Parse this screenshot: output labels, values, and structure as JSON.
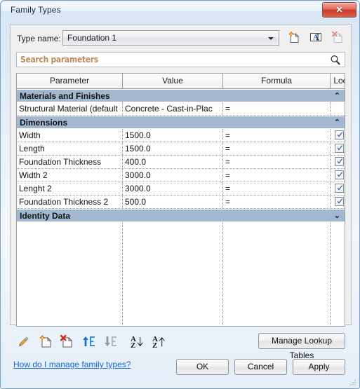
{
  "window": {
    "title": "Family Types",
    "close_label": "✕"
  },
  "typeRow": {
    "label": "Type name:",
    "value": "Foundation 1",
    "actions": [
      {
        "name": "new-type-icon",
        "title": "New Type"
      },
      {
        "name": "rename-type-icon",
        "title": "Rename Type"
      },
      {
        "name": "delete-type-icon",
        "title": "Delete Type"
      }
    ]
  },
  "search": {
    "placeholder": "Search parameters",
    "value": ""
  },
  "grid": {
    "columns": [
      "Parameter",
      "Value",
      "Formula",
      "Lock"
    ],
    "groups": [
      {
        "name": "Materials and Finishes",
        "expanded": true,
        "chevron": "⌃",
        "rows": [
          {
            "parameter": "Structural Material (default",
            "value": "Concrete - Cast-in-Plac",
            "formula": "=",
            "lock": false
          }
        ]
      },
      {
        "name": "Dimensions",
        "expanded": true,
        "chevron": "⌃",
        "rows": [
          {
            "parameter": "Width",
            "value": "1500.0",
            "formula": "=",
            "lock": true
          },
          {
            "parameter": "Length",
            "value": "1500.0",
            "formula": "=",
            "lock": true
          },
          {
            "parameter": "Foundation Thickness",
            "value": "400.0",
            "formula": "=",
            "lock": true
          },
          {
            "parameter": "Width 2",
            "value": "3000.0",
            "formula": "=",
            "lock": true
          },
          {
            "parameter": "Lenght 2",
            "value": "3000.0",
            "formula": "=",
            "lock": true
          },
          {
            "parameter": "Foundation Thickness 2",
            "value": "500.0",
            "formula": "=",
            "lock": true
          }
        ]
      },
      {
        "name": "Identity Data",
        "expanded": false,
        "chevron": "⌄",
        "rows": []
      }
    ]
  },
  "toolbar": [
    {
      "name": "edit-parameter-icon",
      "title": "Edit Parameter"
    },
    {
      "name": "new-parameter-icon",
      "title": "New Parameter"
    },
    {
      "name": "delete-parameter-icon",
      "title": "Remove Parameter"
    },
    {
      "name": "move-parameter-up-icon",
      "title": "Move Up"
    },
    {
      "name": "move-parameter-down-icon",
      "title": "Move Down"
    },
    {
      "name": "sort-descending-icon",
      "title": "Sort Descending"
    },
    {
      "name": "sort-ascending-icon",
      "title": "Sort Ascending"
    }
  ],
  "buttons": {
    "lookup": "Manage Lookup Tables",
    "ok": "OK",
    "cancel": "Cancel",
    "apply": "Apply"
  },
  "help": {
    "link": "How do I manage family types?"
  },
  "colors": {
    "group_header": "#a3b8d0",
    "link": "#1668d0",
    "search_placeholder": "#b0763f",
    "close_button": "#c63a2a"
  },
  "metrics": {
    "col_parameter_width": 150,
    "col_value_width": 143,
    "col_formula_width": 153,
    "col_lock_width": 34
  }
}
